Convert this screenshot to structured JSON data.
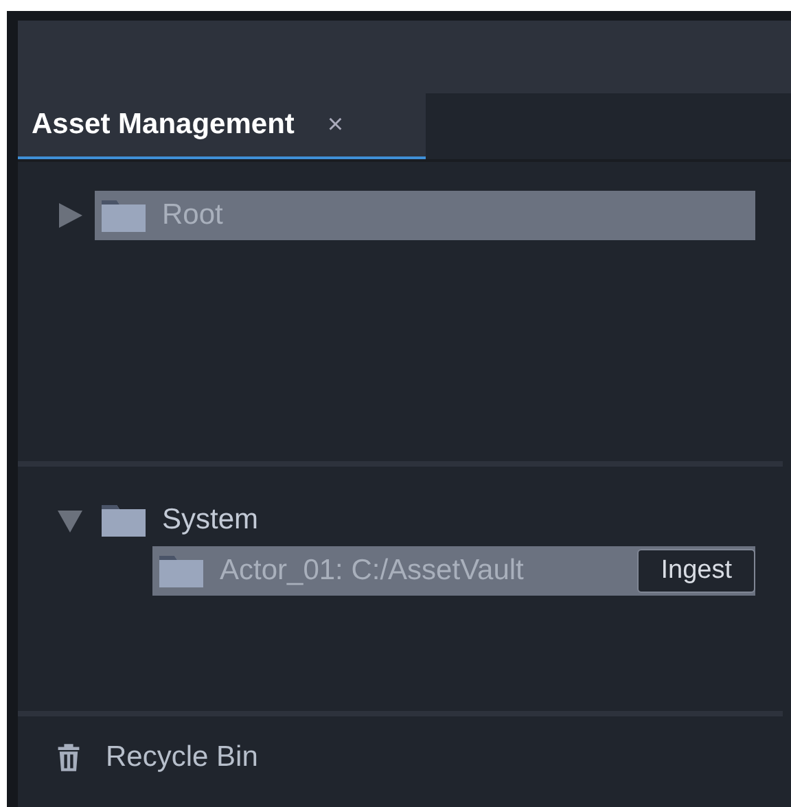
{
  "tabs": [
    {
      "label": "Asset Management",
      "close": "×",
      "selected": true
    }
  ],
  "sections": [
    {
      "items": [
        {
          "label": "Root",
          "expanded": false,
          "selected": true
        }
      ]
    },
    {
      "items": [
        {
          "label": "System",
          "expanded": true,
          "selected": false,
          "children": [
            {
              "label": "Actor_01: C:/AssetVault",
              "selected": true,
              "action": "Ingest"
            }
          ]
        }
      ]
    }
  ],
  "footer": {
    "label": "Recycle Bin"
  }
}
